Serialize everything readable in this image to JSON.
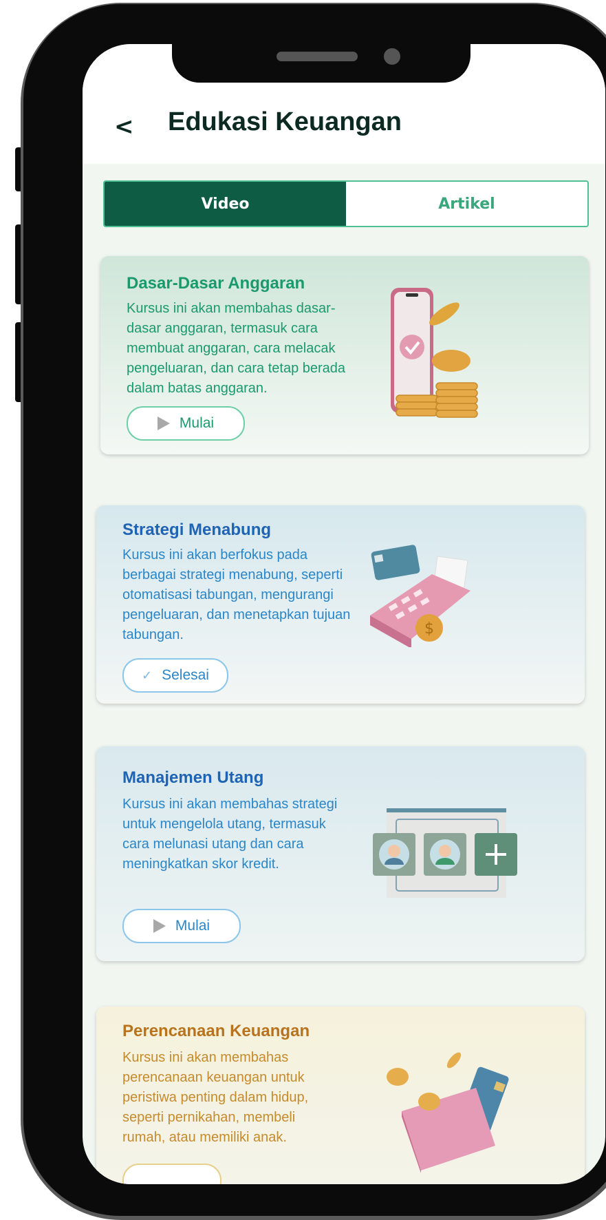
{
  "header": {
    "back_label": "<",
    "title": "Edukasi Keuangan"
  },
  "tabs": [
    {
      "label": "Video",
      "active": true
    },
    {
      "label": "Artikel",
      "active": false
    }
  ],
  "courses": [
    {
      "title": "Dasar-Dasar Anggaran",
      "description": "Kursus ini akan membahas dasar-dasar anggaran, termasuk cara membuat anggaran, cara melacak pengeluaran, dan cara tetap berada dalam batas anggaran.",
      "button_label": "Mulai",
      "button_icon": "play-icon",
      "illustration": "phone-coins-illustration"
    },
    {
      "title": "Strategi Menabung",
      "description": " Kursus ini akan berfokus pada berbagai strategi menabung, seperti otomatisasi tabungan, mengurangi pengeluaran, dan menetapkan tujuan tabungan.",
      "button_label": "Selesai",
      "button_icon": "check-icon",
      "illustration": "card-terminal-illustration"
    },
    {
      "title": "Manajemen Utang",
      "description": "Kursus ini akan membahas strategi untuk mengelola utang, termasuk cara melunasi utang dan cara meningkatkan skor kredit.",
      "button_label": "Mulai",
      "button_icon": "play-icon",
      "illustration": "profiles-board-illustration"
    },
    {
      "title": "Perencanaan Keuangan",
      "description": "Kursus ini akan membahas perencanaan keuangan untuk peristiwa penting dalam hidup, seperti pernikahan, membeli rumah, atau memiliki anak.",
      "button_label": "",
      "button_icon": "",
      "illustration": "wallet-coins-illustration"
    }
  ],
  "colors": {
    "primary": "#0d5c43",
    "green_text": "#1a9a6c",
    "blue_title": "#1f63b5",
    "orange_title": "#b8731c"
  }
}
